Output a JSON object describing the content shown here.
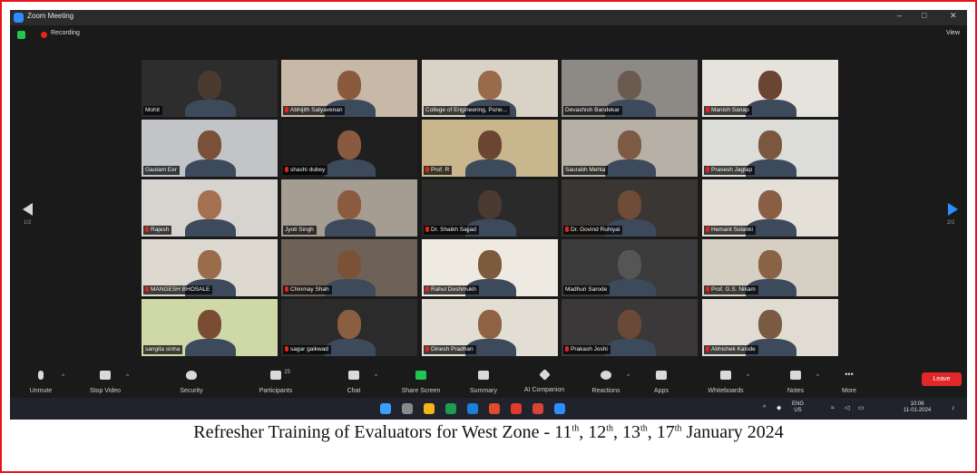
{
  "window": {
    "title": "Zoom Meeting",
    "recording_label": "Recording",
    "view_label": "View",
    "controls": [
      "–",
      "□",
      "✕"
    ]
  },
  "participants": [
    {
      "name": "Mohit",
      "muted": false
    },
    {
      "name": "Abhijith Satyavenan",
      "muted": true
    },
    {
      "name": "College of Engineering, Pune...",
      "muted": false
    },
    {
      "name": "Devashish Bandekar",
      "muted": false
    },
    {
      "name": "Manish Sanap",
      "muted": true
    },
    {
      "name": "Gautam Eer",
      "muted": false
    },
    {
      "name": "shashi dubey",
      "muted": true
    },
    {
      "name": "Prof. R",
      "muted": true
    },
    {
      "name": "Saurabh Mehta",
      "muted": false
    },
    {
      "name": "Pravesh Jagtap",
      "muted": true
    },
    {
      "name": "Rajesh",
      "muted": true
    },
    {
      "name": "Jyoti Singh",
      "muted": false
    },
    {
      "name": "Dr. Shaikh Sajjad",
      "muted": true
    },
    {
      "name": "Dr. Govind Ruhiyal",
      "muted": true
    },
    {
      "name": "Hemant Solanki",
      "muted": true
    },
    {
      "name": "MANGESH BHOSALE",
      "muted": true
    },
    {
      "name": "Chinmay Shah",
      "muted": true
    },
    {
      "name": "Rahul Deshmukh",
      "muted": true
    },
    {
      "name": "Madhuri Sarode",
      "muted": false
    },
    {
      "name": "Prof. G.S. Nikam",
      "muted": true
    },
    {
      "name": "sangita sinha",
      "muted": false
    },
    {
      "name": "sagar gaikwad",
      "muted": true
    },
    {
      "name": "Dinesh Pradhan",
      "muted": true
    },
    {
      "name": "Prakash Joshi",
      "muted": true
    },
    {
      "name": "Abhishek Kalode",
      "muted": true
    }
  ],
  "pager": {
    "left": "1/2",
    "right": "2/2"
  },
  "toolbar": {
    "unmute": "Unmute",
    "stop_video": "Stop Video",
    "security": "Security",
    "participants": "Participants",
    "participants_count": "25",
    "chat": "Chat",
    "share_screen": "Share Screen",
    "summary": "Summary",
    "ai_companion": "AI Companion",
    "reactions": "Reactions",
    "apps": "Apps",
    "whiteboards": "Whiteboards",
    "notes": "Notes",
    "more": "More",
    "leave": "Leave"
  },
  "taskbar": {
    "lang_top": "ENG",
    "lang_bottom": "US",
    "time": "10:06",
    "date": "11-01-2024"
  },
  "caption": {
    "text_before": "Refresher Training of Evaluators for West Zone - 11",
    "sup1": "th",
    "sep1": ", 12",
    "sup2": "th",
    "sep2": ", 13",
    "sup3": "th",
    "sep3": ", 17",
    "sup4": "th",
    "text_after": " January 2024"
  },
  "colors": {
    "frame": "#e8121b",
    "zoom_bg": "#1a1a1a",
    "accent_blue": "#2d8cff",
    "share_green": "#23c552",
    "leave_red": "#e02828",
    "active_speaker": "#c7e85d"
  }
}
